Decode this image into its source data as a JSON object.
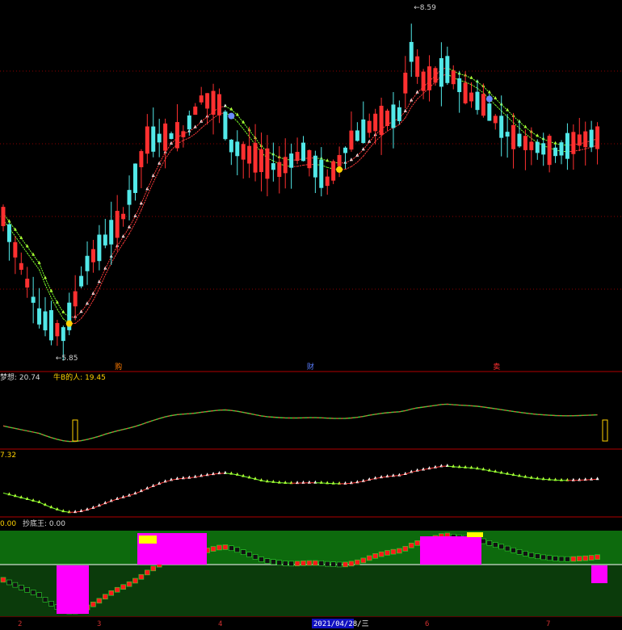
{
  "chart_data": [
    {
      "type": "candlestick",
      "panel": "price",
      "annotations": {
        "high_label": "8.59",
        "low_label": "5.85"
      },
      "ylim": [
        5.7,
        8.75
      ],
      "markers": [
        "购",
        "财",
        "卖"
      ],
      "colors": {
        "up": "#ff3030",
        "down": "#52e8e8",
        "band_up": "#ff3a3a",
        "band_down": "#7cff2a",
        "grid": "#8b0000"
      }
    },
    {
      "type": "line",
      "panel": "indicator-1",
      "legend": [
        {
          "name": "梦想",
          "value": "20.74",
          "color": "#d8d8d8"
        },
        {
          "name": "牛B的人",
          "value": "19.45",
          "color": "#ffd200"
        }
      ]
    },
    {
      "type": "line",
      "panel": "indicator-2",
      "legend": [
        {
          "name": "",
          "value": "7.32",
          "color": "#ffd200"
        }
      ]
    },
    {
      "type": "area",
      "panel": "indicator-3",
      "legend": [
        {
          "name": "",
          "value": "0.00",
          "color": "#ffd200"
        },
        {
          "name": "抄底王",
          "value": "0.00",
          "color": "#d8d8d8"
        }
      ],
      "colors": {
        "fill_top": "#ff00ff",
        "fill_stair": "#ff1a1a",
        "fill_cap": "#ffff00",
        "bg": "#0d6a0d"
      }
    }
  ],
  "x_axis": {
    "ticks": [
      "2",
      "3",
      "4",
      "2021/04/28/三",
      "6",
      "7"
    ]
  }
}
